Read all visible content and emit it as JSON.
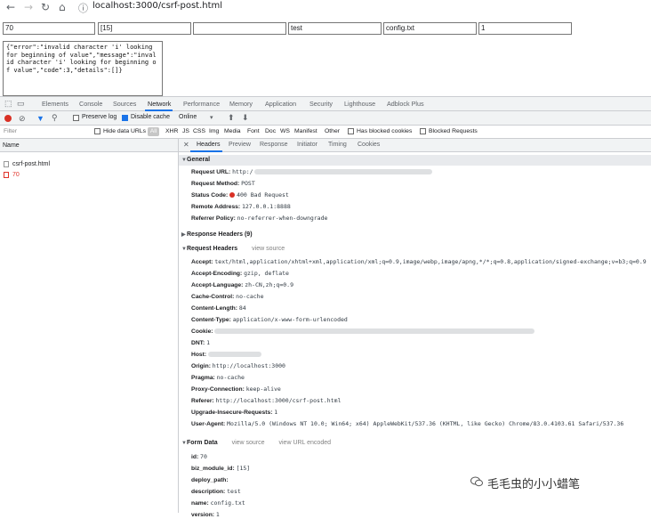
{
  "browser": {
    "url": "localhost:3000/csrf-post.html"
  },
  "page": {
    "fields": [
      "70",
      "[15]",
      "",
      "test",
      "config.txt",
      "1"
    ],
    "result_text": "{\"error\":\"invalid character 'i' looking for beginning of value\",\"message\":\"invalid character 'i' looking for beginning of value\",\"code\":3,\"details\":[]}"
  },
  "devtools": {
    "tabs": [
      "Elements",
      "Console",
      "Sources",
      "Network",
      "Performance",
      "Memory",
      "Application",
      "Security",
      "Lighthouse",
      "Adblock Plus"
    ],
    "toolbar": {
      "preserve_log": "Preserve log",
      "disable_cache": "Disable cache",
      "throttle": "Online"
    },
    "filter": {
      "placeholder": "Filter",
      "hide_data_urls": "Hide data URLs",
      "types": [
        "All",
        "XHR",
        "JS",
        "CSS",
        "Img",
        "Media",
        "Font",
        "Doc",
        "WS",
        "Manifest",
        "Other"
      ],
      "has_blocked_cookies": "Has blocked cookies",
      "blocked_requests": "Blocked Requests"
    },
    "list_header": "Name",
    "requests": [
      "csrf-post.html",
      "70"
    ],
    "detail_tabs": [
      "Headers",
      "Preview",
      "Response",
      "Initiator",
      "Timing",
      "Cookies"
    ],
    "general": {
      "title": "General",
      "request_url_label": "Request URL:",
      "request_url_value": "http:/",
      "request_method_label": "Request Method:",
      "request_method_value": "POST",
      "status_code_label": "Status Code:",
      "status_code_value": "400 Bad Request",
      "remote_address_label": "Remote Address:",
      "remote_address_value": "127.0.0.1:8888",
      "referrer_policy_label": "Referrer Policy:",
      "referrer_policy_value": "no-referrer-when-downgrade"
    },
    "response_headers_title": "Response Headers (9)",
    "request_headers": {
      "title": "Request Headers",
      "view_source": "view source",
      "items": [
        {
          "k": "Accept:",
          "v": "text/html,application/xhtml+xml,application/xml;q=0.9,image/webp,image/apng,*/*;q=0.8,application/signed-exchange;v=b3;q=0.9"
        },
        {
          "k": "Accept-Encoding:",
          "v": "gzip, deflate"
        },
        {
          "k": "Accept-Language:",
          "v": "zh-CN,zh;q=0.9"
        },
        {
          "k": "Cache-Control:",
          "v": "no-cache"
        },
        {
          "k": "Content-Length:",
          "v": "84"
        },
        {
          "k": "Content-Type:",
          "v": "application/x-www-form-urlencoded"
        },
        {
          "k": "Cookie:",
          "v": ""
        },
        {
          "k": "DNT:",
          "v": "1"
        },
        {
          "k": "Host:",
          "v": ""
        },
        {
          "k": "Origin:",
          "v": "http://localhost:3000"
        },
        {
          "k": "Pragma:",
          "v": "no-cache"
        },
        {
          "k": "Proxy-Connection:",
          "v": "keep-alive"
        },
        {
          "k": "Referer:",
          "v": "http://localhost:3000/csrf-post.html"
        },
        {
          "k": "Upgrade-Insecure-Requests:",
          "v": "1"
        },
        {
          "k": "User-Agent:",
          "v": "Mozilla/5.0 (Windows NT 10.0; Win64; x64) AppleWebKit/537.36 (KHTML, like Gecko) Chrome/83.0.4103.61 Safari/537.36"
        }
      ]
    },
    "form_data": {
      "title": "Form Data",
      "view_source": "view source",
      "view_url_encoded": "view URL encoded",
      "items": [
        {
          "k": "id:",
          "v": "70"
        },
        {
          "k": "biz_module_id:",
          "v": "[15]"
        },
        {
          "k": "deploy_path:",
          "v": ""
        },
        {
          "k": "description:",
          "v": "test"
        },
        {
          "k": "name:",
          "v": "config.txt"
        },
        {
          "k": "version:",
          "v": "1"
        }
      ]
    }
  },
  "watermark": "毛毛虫的小小蜡笔"
}
